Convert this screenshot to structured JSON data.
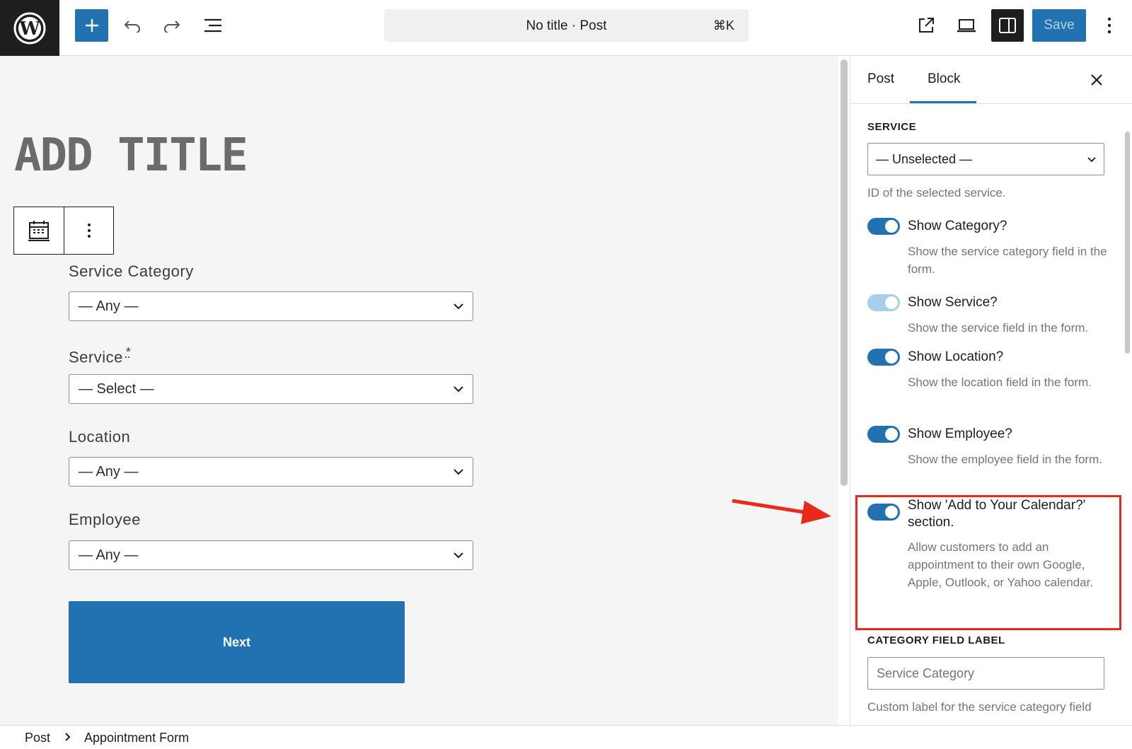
{
  "topbar": {
    "document_title": "No title · Post",
    "shortcut": "⌘K",
    "save_label": "Save"
  },
  "editor": {
    "page_title_placeholder": "ADD TITLE",
    "fields": [
      {
        "label": "Service Category",
        "value": "— Any —",
        "required": false
      },
      {
        "label": "Service",
        "value": "— Select —",
        "required": true,
        "required_mark": "*"
      },
      {
        "label": "Location",
        "value": "— Any —",
        "required": false
      },
      {
        "label": "Employee",
        "value": "— Any —",
        "required": false
      }
    ],
    "next_label": "Next"
  },
  "sidebar": {
    "tabs": [
      {
        "label": "Post",
        "active": false
      },
      {
        "label": "Block",
        "active": true
      }
    ],
    "service_heading": "SERVICE",
    "service_select": "— Unselected —",
    "service_help": "ID of the selected service.",
    "toggles": [
      {
        "label": "Show Category?",
        "help": "Show the service category field in the form.",
        "on": true,
        "disabled": false
      },
      {
        "label": "Show Service?",
        "help": "Show the service field in the form.",
        "on": true,
        "disabled": true
      },
      {
        "label": "Show Location?",
        "help": "Show the location field in the form.",
        "on": true,
        "disabled": false
      },
      {
        "label": "Show Employee?",
        "help": "Show the employee field in the form.",
        "on": true,
        "disabled": false
      },
      {
        "label": "Show 'Add to Your Calendar?' section.",
        "help": "Allow customers to add an appointment to their own Google, Apple, Outlook, or Yahoo calendar.",
        "on": true,
        "disabled": false
      }
    ],
    "category_label_heading": "CATEGORY FIELD LABEL",
    "category_label_placeholder": "Service Category",
    "category_label_help": "Custom label for the service category field"
  },
  "breadcrumb": [
    "Post",
    "Appointment Form"
  ],
  "colors": {
    "accent": "#2271b1",
    "highlight": "#e8291c",
    "canvas_bg": "#f5f5f5"
  }
}
